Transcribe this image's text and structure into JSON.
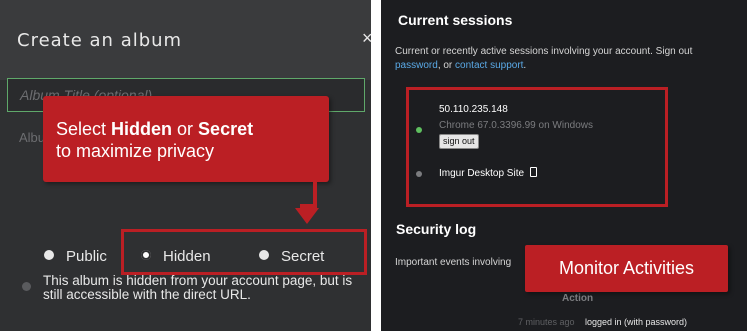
{
  "album_dialog": {
    "title": "Create an album",
    "close_label": "×",
    "title_input_placeholder": "Album Title (optional)",
    "description_placeholder": "Album description",
    "privacy_options": [
      {
        "label": "Public",
        "selected": false
      },
      {
        "label": "Hidden",
        "selected": true
      },
      {
        "label": "Secret",
        "selected": false
      }
    ],
    "privacy_note": "This album is hidden from your account page, but is still accessible with the direct URL."
  },
  "callouts": {
    "left_line1_pre": "Select ",
    "left_line1_b1": "Hidden",
    "left_line1_mid": " or ",
    "left_line1_b2": "Secret",
    "left_line2": "to maximize privacy",
    "right": "Monitor Activities"
  },
  "sessions": {
    "title": "Current sessions",
    "desc_pre": "Current or recently active sessions involving your account. Sign out",
    "link1": "password",
    "desc_mid": ", or ",
    "link2": "contact support",
    "desc_end": ".",
    "items": [
      {
        "ip": "50.110.235.148",
        "browser": "Chrome 67.0.3396.99 on Windows",
        "button": "sign out"
      },
      {
        "name": "Imgur Desktop Site"
      }
    ]
  },
  "security_log": {
    "title": "Security log",
    "description": "Important events involving",
    "column_action": "Action",
    "rows": [
      {
        "time": "7 minutes ago",
        "event": "logged in (with password)"
      }
    ]
  },
  "colors": {
    "accent": "#bb1f24",
    "link": "#5aa9e6",
    "active_session": "#5fbf5f"
  }
}
